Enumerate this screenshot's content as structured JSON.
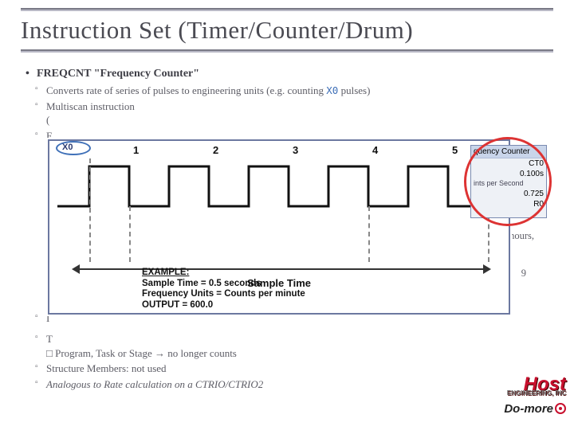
{
  "title": "Instruction Set (Timer/Counter/Drum)",
  "main_bullet": "FREQCNT \"Frequency Counter\"",
  "bullets": {
    "b1": "Converts rate of series of pulses to engineering units (e.g. counting ",
    "b1_hl": "X0",
    "b1_tail": " pulses)",
    "b2a": "Multiscan instruction",
    "b2b": "(",
    "b3": "F",
    "b4": "I",
    "b5a": "T",
    "b5b": "  Program, Task or Stage ",
    "b5c": " no longer counts",
    "b6": "Structure Members: not used",
    "b7": "Analogous to Rate calculation on a CTRIO/CTRIO2"
  },
  "stray": {
    "hours": "hours,",
    "nine": "9"
  },
  "diagram": {
    "signal": "X0",
    "nums": [
      "1",
      "2",
      "3",
      "4",
      "5"
    ],
    "sample_label": "Sample Time",
    "example_heading": "EXAMPLE:",
    "ex1": "Sample Time = 0.5 seconds",
    "ex2": "Frequency Units = Counts per minute",
    "ex3": "OUTPUT = 600.0"
  },
  "param": {
    "header": "quency Counter",
    "ct": "CT0",
    "time": "0.100s",
    "unit": "ints per Second",
    "scale": "0.725",
    "reg": "R0"
  },
  "logo": {
    "host": "Host",
    "tag": "ENGINEERING, INC",
    "domore": "Do-more"
  },
  "chart_data": {
    "type": "timing-diagram",
    "signal_name": "X0",
    "pulses_in_sample": 5,
    "sample_time_seconds": 0.5,
    "frequency_units": "Counts per minute",
    "output_value": 600.0,
    "note": "Square-wave pulse train; rising edges numbered 1–5 occur within one Sample Time window."
  }
}
